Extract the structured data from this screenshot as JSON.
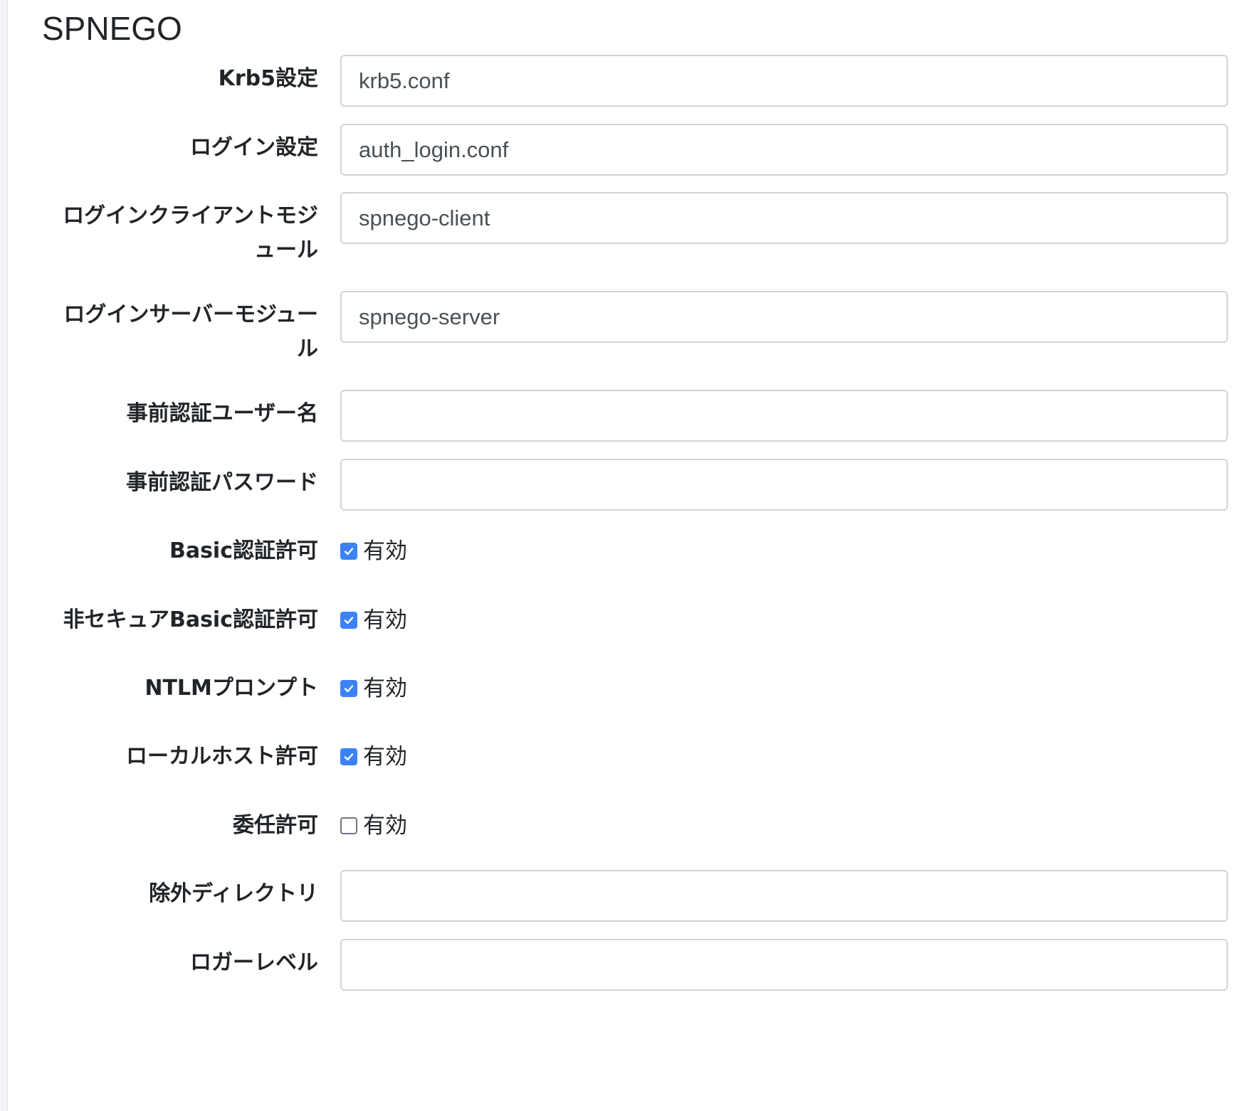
{
  "section": {
    "title": "SPNEGO"
  },
  "fields": {
    "krb5": {
      "label": "Krb5設定",
      "value": "krb5.conf"
    },
    "login_conf": {
      "label": "ログイン設定",
      "value": "auth_login.conf"
    },
    "login_client_module": {
      "label": "ログインクライアントモジュール",
      "value": "spnego-client"
    },
    "login_server_module": {
      "label": "ログインサーバーモジュール",
      "value": "spnego-server"
    },
    "preauth_username": {
      "label": "事前認証ユーザー名",
      "value": ""
    },
    "preauth_password": {
      "label": "事前認証パスワード",
      "value": ""
    },
    "basic_auth": {
      "label": "Basic認証許可",
      "option_label": "有効",
      "checked": true
    },
    "insecure_basic_auth": {
      "label": "非セキュアBasic認証許可",
      "option_label": "有効",
      "checked": true
    },
    "ntlm_prompt": {
      "label": "NTLMプロンプト",
      "option_label": "有効",
      "checked": true
    },
    "localhost_allow": {
      "label": "ローカルホスト許可",
      "option_label": "有効",
      "checked": true
    },
    "delegation_allow": {
      "label": "委任許可",
      "option_label": "有効",
      "checked": false
    },
    "exclude_dirs": {
      "label": "除外ディレクトリ",
      "value": ""
    },
    "logger_level": {
      "label": "ロガーレベル",
      "value": ""
    }
  },
  "colors": {
    "checkbox_accent": "#3b82f6",
    "input_border": "#ced4da"
  }
}
